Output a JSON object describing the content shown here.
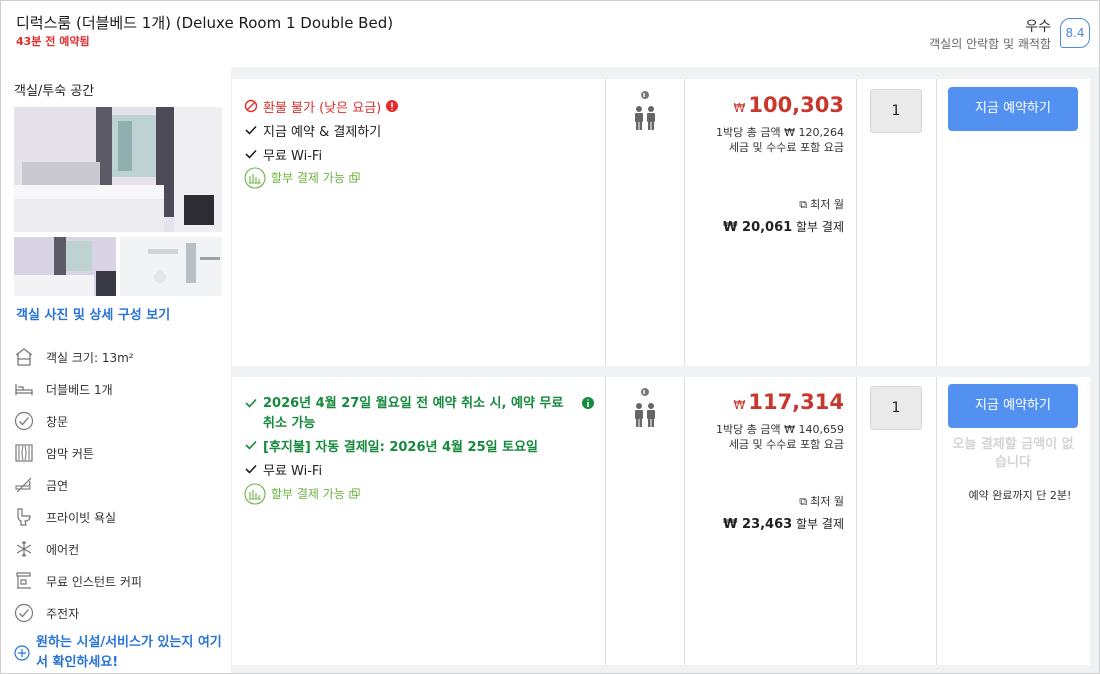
{
  "header": {
    "room_title": "디럭스룸 (더블베드 1개) (Deluxe Room 1 Double Bed)",
    "booked_ago": "43분 전 예약됨",
    "rating_word": "우수",
    "rating_sub": "객실의 안락함 및 쾌적함",
    "score": "8.4"
  },
  "left_panel": {
    "title": "객실/투숙 공간",
    "photos_link": "객실 사진 및 상세 구성 보기",
    "amenities": [
      {
        "icon": "room-size-icon",
        "label": "객실 크기: 13m²"
      },
      {
        "icon": "bed-icon",
        "label": "더블베드 1개"
      },
      {
        "icon": "check-circle-icon",
        "label": "창문"
      },
      {
        "icon": "curtain-icon",
        "label": "암막 커튼"
      },
      {
        "icon": "no-smoking-icon",
        "label": "금연"
      },
      {
        "icon": "toilet-icon",
        "label": "프라이빗 욕실"
      },
      {
        "icon": "snowflake-icon",
        "label": "에어컨"
      },
      {
        "icon": "coffee-machine-icon",
        "label": "무료 인스턴트 커피"
      },
      {
        "icon": "check-circle-icon",
        "label": "주전자"
      }
    ],
    "more_link": "원하는 시설/서비스가 있는지 여기서 확인하세요!"
  },
  "offers": [
    {
      "features": [
        {
          "type": "red",
          "icon": "no-entry-icon",
          "text": "환불 불가 (낮은 요금)"
        },
        {
          "type": "plain",
          "icon": "checkmark-icon",
          "text": "지금 예약 & 결제하기"
        },
        {
          "type": "plain",
          "icon": "checkmark-icon",
          "text": "무료 Wi-Fi"
        },
        {
          "type": "inst",
          "icon": "installment-icon",
          "text": "할부 결제 가능"
        }
      ],
      "currency": "₩",
      "price": "100,303",
      "total_line": "1박당 총 금액 ₩ 120,264",
      "tax_line": "세금 및 수수료 포함 요금",
      "lowest_label": "최저 월",
      "monthly_amount": "₩ 20,061",
      "monthly_label": "할부 결제",
      "quantity": "1",
      "book_label": "지금 예약하기"
    },
    {
      "features": [
        {
          "type": "green",
          "icon": "checkmark-icon",
          "text": "2026년 4월 27일 월요일 전 예약 취소 시, 예약 무료 취소 가능"
        },
        {
          "type": "green",
          "icon": "checkmark-icon",
          "text": "[후지불] 자동 결제일: 2026년 4월 25일 토요일"
        },
        {
          "type": "plain",
          "icon": "checkmark-icon",
          "text": "무료 Wi-Fi"
        },
        {
          "type": "inst",
          "icon": "installment-icon",
          "text": "할부 결제 가능"
        }
      ],
      "currency": "₩",
      "price": "117,314",
      "total_line": "1박당 총 금액 ₩ 140,659",
      "tax_line": "세금 및 수수료 포함 요금",
      "lowest_label": "최저 월",
      "monthly_amount": "₩ 23,463",
      "monthly_label": "할부 결제",
      "quantity": "1",
      "book_label": "지금 예약하기",
      "no_pay_today": "오늘 결제할 금액이 없습니다",
      "time_note": "예약 완료까지 단 2분!"
    }
  ],
  "colors": {
    "accent_blue": "#5391f0",
    "price_red": "#c8372d",
    "free_cancel_green": "#158a3c",
    "installment_green": "#6cb33f"
  }
}
